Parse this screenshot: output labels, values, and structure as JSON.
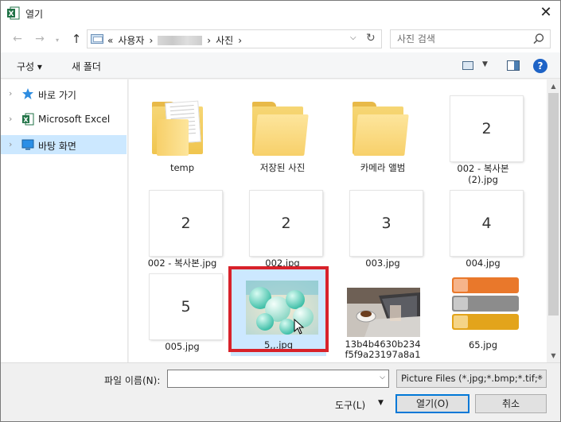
{
  "window": {
    "title": "열기"
  },
  "address": {
    "root": "«",
    "crumbs": [
      "사용자",
      "사진"
    ],
    "sep": "›"
  },
  "search": {
    "placeholder": "사진 검색"
  },
  "toolbar": {
    "organize": "구성 ▾",
    "new_folder": "새 폴더"
  },
  "nav": [
    {
      "label": "바로 가기",
      "icon": "star-icon",
      "selected": false
    },
    {
      "label": "Microsoft Excel",
      "icon": "excel-icon",
      "selected": false
    },
    {
      "label": "바탕 화면",
      "icon": "desktop-icon",
      "selected": true
    }
  ],
  "files": [
    {
      "name": "temp",
      "kind": "folder-docs"
    },
    {
      "name": "저장된 사진",
      "kind": "folder"
    },
    {
      "name": "카메라 앨범",
      "kind": "folder"
    },
    {
      "name": "002 - 복사본\n(2).jpg",
      "kind": "num",
      "thumb": "2"
    },
    {
      "name": "002 - 복사본.jpg",
      "kind": "num",
      "thumb": "2"
    },
    {
      "name": "002.jpg",
      "kind": "num",
      "thumb": "2"
    },
    {
      "name": "003.jpg",
      "kind": "num",
      "thumb": "3"
    },
    {
      "name": "004.jpg",
      "kind": "num",
      "thumb": "4"
    },
    {
      "name": "005.jpg",
      "kind": "num",
      "thumb": "5"
    },
    {
      "name": "5,,.jpg",
      "kind": "photo-balloons",
      "selected": true
    },
    {
      "name": "13b4b4630b234\nf5f9a23197a8a1",
      "kind": "photo-laptop"
    },
    {
      "name": "65.jpg",
      "kind": "photo-bars"
    }
  ],
  "bottom": {
    "filename_label": "파일 이름(N):",
    "filename_value": "",
    "filter": "Picture Files (*.jpg;*.bmp;*.tif;*",
    "tools": "도구(L)",
    "open": "열기(O)",
    "cancel": "취소"
  },
  "colors": {
    "accent": "#0078d7",
    "selection": "#cce8ff",
    "highlight_box": "#d8222a"
  }
}
